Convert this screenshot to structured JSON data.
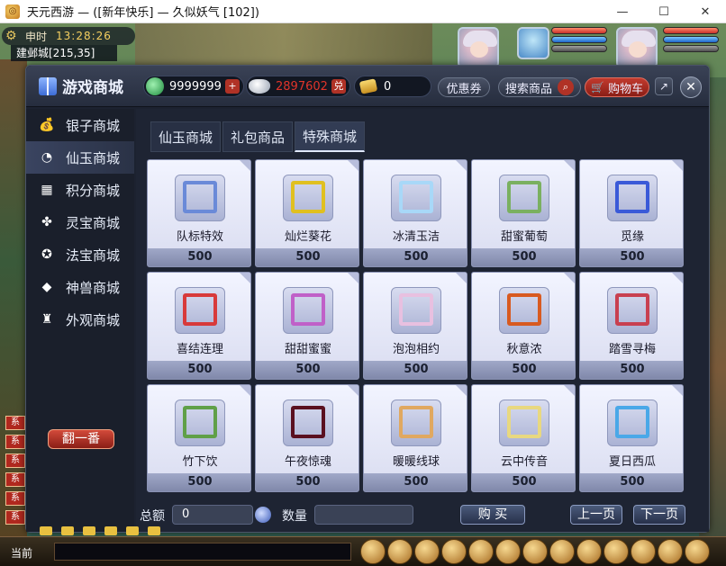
{
  "window": {
    "title": "天元西游 — ([新年快乐] — 久似妖气 [102])",
    "minimize": "—",
    "maximize": "☐",
    "close": "✕"
  },
  "hud": {
    "shichen": "申时",
    "clock": "13:28:26",
    "location": "建邺城[215,35]"
  },
  "shop": {
    "title": "游戏商城",
    "currencies": {
      "jade": "9999999",
      "silver": "2897602",
      "ticket": "0"
    },
    "plus": "+",
    "coupon_label": "优惠券",
    "search_label": "搜索商品",
    "cart_label": "购物车",
    "close": "✕"
  },
  "sidebar": {
    "items": [
      {
        "label": "银子商城",
        "icon": "money-bag-icon"
      },
      {
        "label": "仙玉商城",
        "icon": "jade-icon"
      },
      {
        "label": "积分商城",
        "icon": "gift-icon"
      },
      {
        "label": "灵宝商城",
        "icon": "clover-icon"
      },
      {
        "label": "法宝商城",
        "icon": "magic-treasure-icon"
      },
      {
        "label": "神兽商城",
        "icon": "beast-icon"
      },
      {
        "label": "外观商城",
        "icon": "shirt-icon"
      }
    ],
    "flip_label": "翻一番"
  },
  "tabs": [
    "仙玉商城",
    "礼包商品",
    "特殊商城"
  ],
  "items": [
    {
      "name": "队标特效",
      "price": "500",
      "frame_color": "#6a8ad8"
    },
    {
      "name": "灿烂葵花",
      "price": "500",
      "frame_color": "#e0c020"
    },
    {
      "name": "冰清玉洁",
      "price": "500",
      "frame_color": "#a8d8f8"
    },
    {
      "name": "甜蜜葡萄",
      "price": "500",
      "frame_color": "#7ab060"
    },
    {
      "name": "觅缘",
      "price": "500",
      "frame_color": "#3a5ad8"
    },
    {
      "name": "喜结连理",
      "price": "500",
      "frame_color": "#d83a3a"
    },
    {
      "name": "甜甜蜜蜜",
      "price": "500",
      "frame_color": "#c060c8"
    },
    {
      "name": "泡泡相约",
      "price": "500",
      "frame_color": "#e8c0e0"
    },
    {
      "name": "秋意浓",
      "price": "500",
      "frame_color": "#d85a20"
    },
    {
      "name": "踏雪寻梅",
      "price": "500",
      "frame_color": "#c84050"
    },
    {
      "name": "竹下饮",
      "price": "500",
      "frame_color": "#60a048"
    },
    {
      "name": "午夜惊魂",
      "price": "500",
      "frame_color": "#5a1020"
    },
    {
      "name": "暖暖线球",
      "price": "500",
      "frame_color": "#e0a860"
    },
    {
      "name": "云中传音",
      "price": "500",
      "frame_color": "#e8d880"
    },
    {
      "name": "夏日西瓜",
      "price": "500",
      "frame_color": "#4aa8e8"
    }
  ],
  "bottom": {
    "total_label": "总额",
    "total_value": "0",
    "qty_label": "数量",
    "qty_value": "",
    "buy_label": "购 买",
    "prev_label": "上一页",
    "next_label": "下一页"
  },
  "gamebar": {
    "channel_label": "当前"
  },
  "chat_tags": [
    "系",
    "系",
    "系",
    "系",
    "系",
    "系"
  ]
}
